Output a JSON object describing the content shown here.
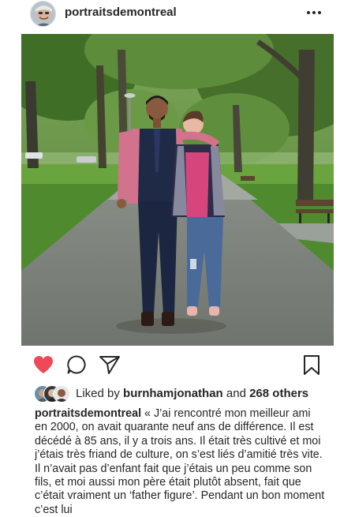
{
  "post": {
    "username": "portraitsdemontreal",
    "liked_by_prefix": "Liked by",
    "liked_by_user": "burnhamjonathan",
    "liked_by_and": "and",
    "liked_by_others": "268 others",
    "caption_user": "portraitsdemontreal",
    "caption_text": "« J’ai rencontré mon meilleur ami en 2000, on avait quarante neuf ans de différence. Il est décédé à 85 ans, il y a trois ans. Il était très cultivé et moi j’étais très friand de culture, on s’est liés d’amitié très vite. Il n’avait pas d’enfant fait que j’étais un peu comme son fils, et moi aussi mon père était plutôt absent, fait que c’était vraiment un ‘father figure’. Pendant un bon moment c’est lui"
  },
  "icons": {
    "more": "more-options-icon",
    "like": "heart-icon",
    "comment": "comment-icon",
    "share": "send-icon",
    "save": "bookmark-icon"
  },
  "colors": {
    "like_active": "#ed4956",
    "text": "#262626"
  }
}
